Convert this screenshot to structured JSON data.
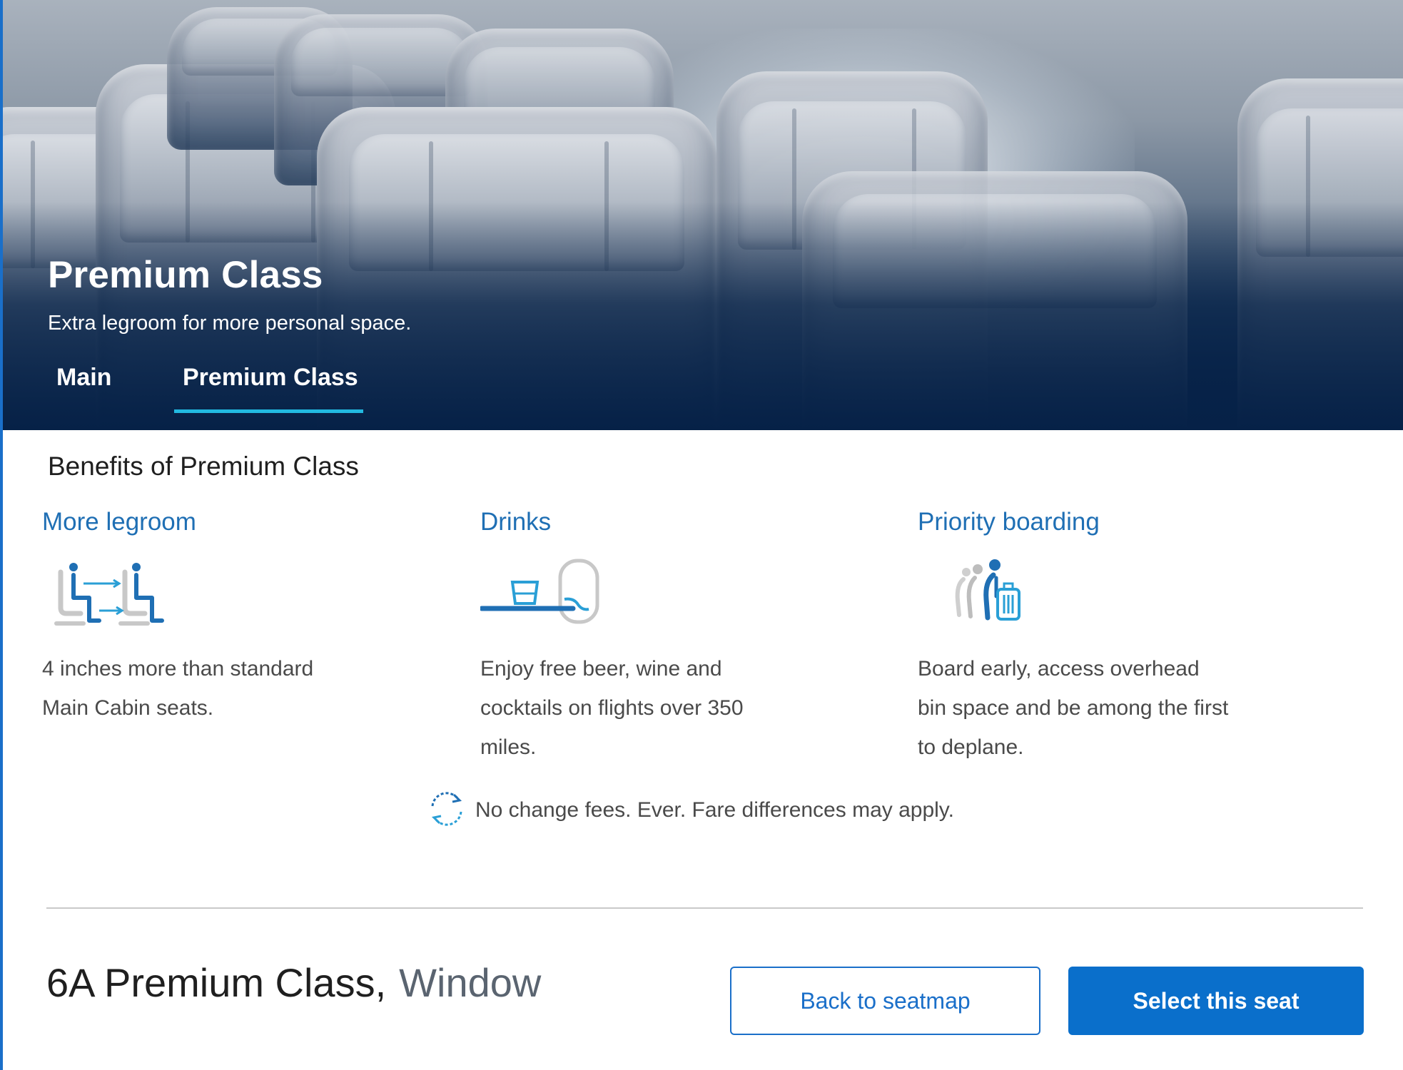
{
  "hero": {
    "title": "Premium Class",
    "subtitle": "Extra legroom for more personal space.",
    "tabs": [
      {
        "label": "Main",
        "active": false
      },
      {
        "label": "Premium Class",
        "active": true
      }
    ]
  },
  "benefits": {
    "heading": "Benefits of Premium Class",
    "items": [
      {
        "title": "More legroom",
        "icon": "legroom-seats-icon",
        "description": "4 inches more than standard Main Cabin seats."
      },
      {
        "title": "Drinks",
        "icon": "tray-table-drink-icon",
        "description": "Enjoy free beer, wine and cocktails on flights over 350 miles."
      },
      {
        "title": "Priority boarding",
        "icon": "priority-boarding-icon",
        "description": "Board early, access overhead bin space and be among the first to deplane."
      }
    ],
    "note": {
      "icon": "refresh-cycle-icon",
      "text": "No change fees. Ever. Fare differences may apply."
    }
  },
  "seat": {
    "label": "6A Premium Class,",
    "position": "Window"
  },
  "actions": {
    "back_label": "Back to seatmap",
    "select_label": "Select this seat"
  },
  "colors": {
    "accent_blue": "#0a6fcb",
    "link_blue": "#1f6fb4",
    "tab_underline": "#22b9e0",
    "hero_navy": "#062147"
  }
}
